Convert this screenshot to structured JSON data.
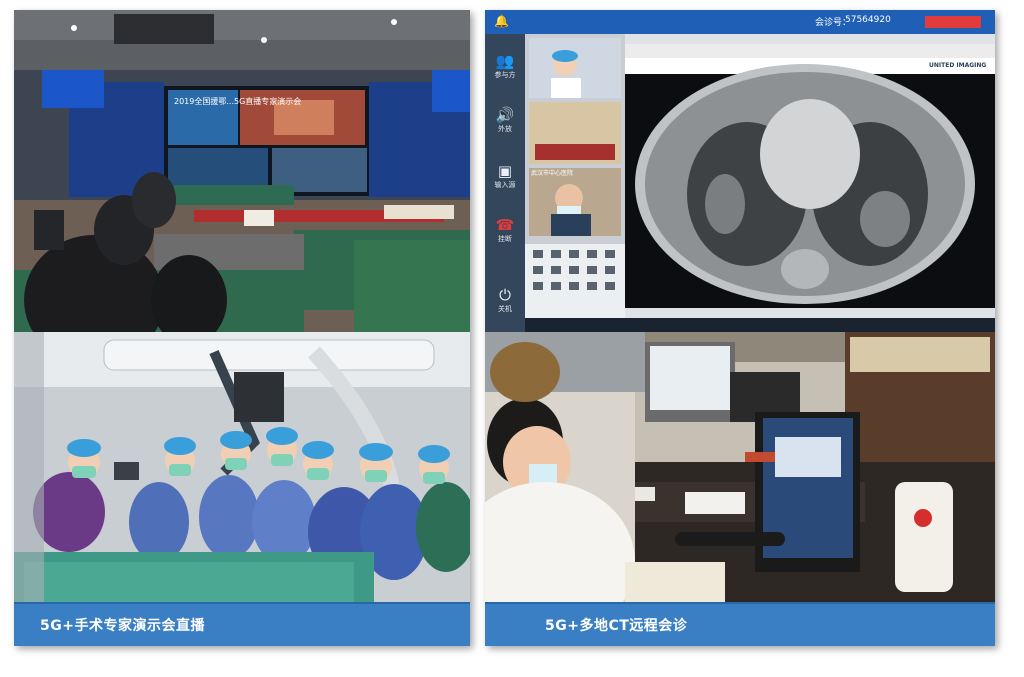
{
  "captions": {
    "left": "5G+手术专家演示会直播",
    "right": "5G+多地CT远程会诊"
  },
  "conference": {
    "banner_text": "2019全国援鄂...5G直播专家演示会",
    "sign_left": "2019全国...5G直播专家演示会"
  },
  "video_call": {
    "meeting_number_label": "会诊号：",
    "meeting_number": "57564920",
    "toolbar": [
      {
        "label": "参与方",
        "icon": "participants-icon"
      },
      {
        "label": "外放",
        "icon": "speaker-icon"
      },
      {
        "label": "输入源",
        "icon": "input-source-icon"
      },
      {
        "label": "挂断",
        "icon": "hangup-icon"
      },
      {
        "label": "关机",
        "icon": "power-icon"
      }
    ],
    "ct_brand": "UNITED IMAGING",
    "pane_label": "武汉市中心医院"
  },
  "colors": {
    "caption_blue": "#3a7fc4",
    "topbar_blue": "#1f5fb6",
    "hangup_red": "#e23b3b"
  }
}
